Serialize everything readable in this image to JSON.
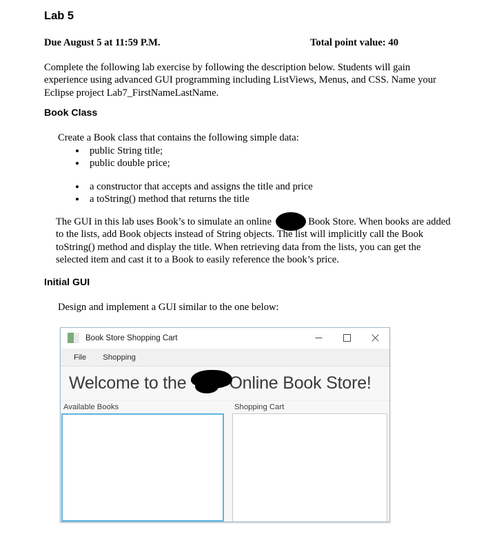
{
  "document": {
    "title": "Lab 5",
    "due_date": "Due August 5 at 11:59 P.M.",
    "total_points": "Total point value: 40",
    "intro_paragraph": "Complete the following lab exercise by following the description below. Students will gain experience using advanced GUI programming including ListViews, Menus, and CSS. Name your Eclipse project Lab7_FirstNameLastName.",
    "book_class_heading": "Book Class",
    "create_book_line": "Create a Book class that contains the following simple data:",
    "fields_bullets": [
      "public String title;",
      "public double price;"
    ],
    "methods_bullets": [
      "a constructor that accepts and assigns the title and price",
      "a toString() method that returns the title"
    ],
    "gui_paragraph_before_redaction": "The GUI in this lab uses Book’s to simulate an online ",
    "gui_paragraph_after_redaction": " Book Store. When books are added to the lists, add Book objects instead of String objects. The list will implicitly call the Book toString() method and display the title. When retrieving data from the lists, you can get the selected item and cast it to a Book to easily reference the book’s price.",
    "initial_gui_heading": "Initial GUI",
    "design_line": "Design and implement a GUI similar to the one below:"
  },
  "app_window": {
    "titlebar": {
      "icon": "app-window-icon",
      "title": "Book Store Shopping Cart",
      "minimize_label": "minimize-icon",
      "maximize_label": "maximize-icon",
      "close_label": "close-icon"
    },
    "menubar": {
      "items": [
        {
          "label": "File"
        },
        {
          "label": "Shopping"
        }
      ]
    },
    "banner": {
      "text_before_redaction": "Welcome to the",
      "text_after_redaction": "Online Book Store!"
    },
    "panes": [
      {
        "label": "Available Books",
        "items": [],
        "focused": true
      },
      {
        "label": "Shopping Cart",
        "items": [],
        "focused": false
      }
    ]
  },
  "colors": {
    "focus_border": "#5fb4de",
    "window_border": "#9cb9cc",
    "menubar_bg": "#f0f0f0",
    "banner_bg": "#f7f7f7",
    "banner_text": "#3a3a3a",
    "redaction": "#000000"
  }
}
